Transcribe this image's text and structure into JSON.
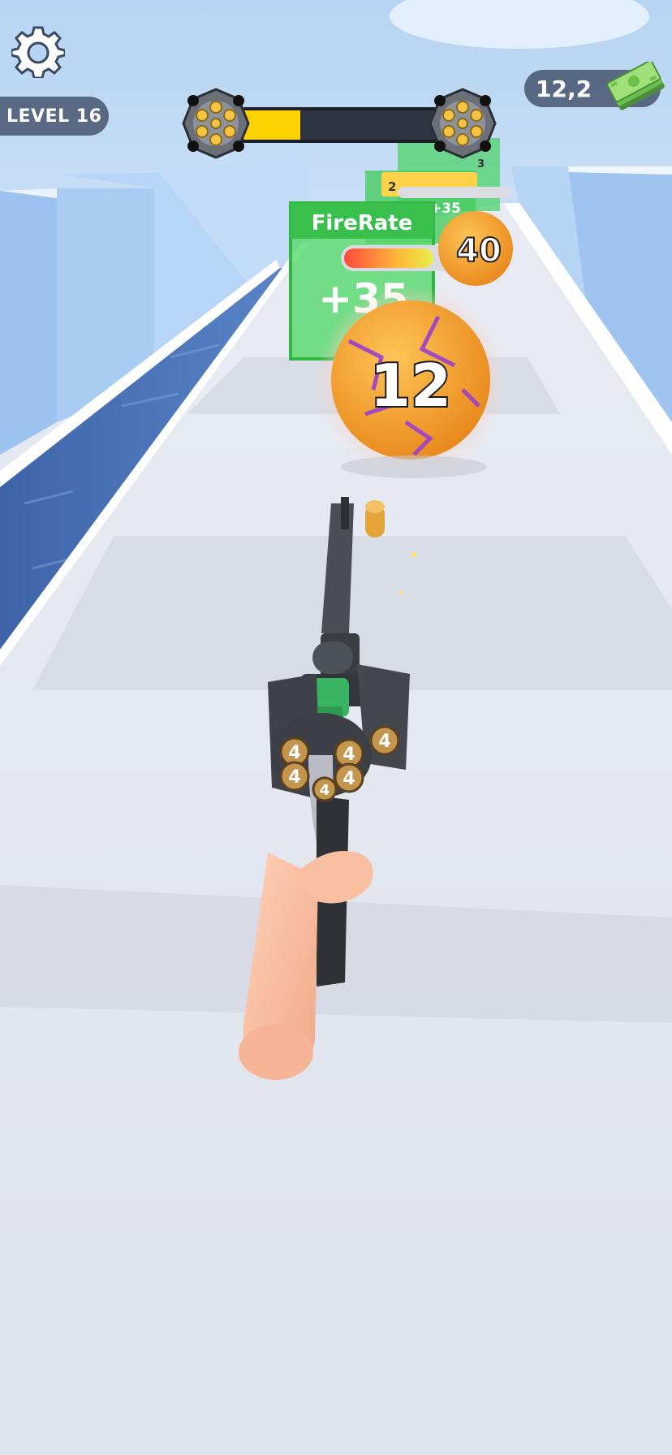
{
  "hud": {
    "level_label": "LEVEL 16",
    "money_value": "12,2",
    "progress_fraction": 0.29,
    "colors": {
      "pill_bg": "#46556e",
      "progress_fill": "#ffd200",
      "progress_track": "#2f3540"
    },
    "icons": {
      "settings": "gear-icon",
      "money": "cash-stack-icon",
      "progress_start": "revolver-cylinder-icon",
      "progress_end": "revolver-cylinder-icon"
    }
  },
  "track": {
    "gate_main": {
      "stat": "FireRate",
      "value": "+35",
      "color": "#3fcf4f"
    },
    "gate_far": {
      "values": [
        "2",
        "3",
        "+35"
      ]
    },
    "balls": [
      {
        "label": "12",
        "color": "#f5a623"
      },
      {
        "label": "40",
        "color": "#f5a623"
      }
    ]
  },
  "gun": {
    "cylinder_bullets": [
      "4",
      "4",
      "4",
      "4",
      "4",
      "4"
    ]
  }
}
